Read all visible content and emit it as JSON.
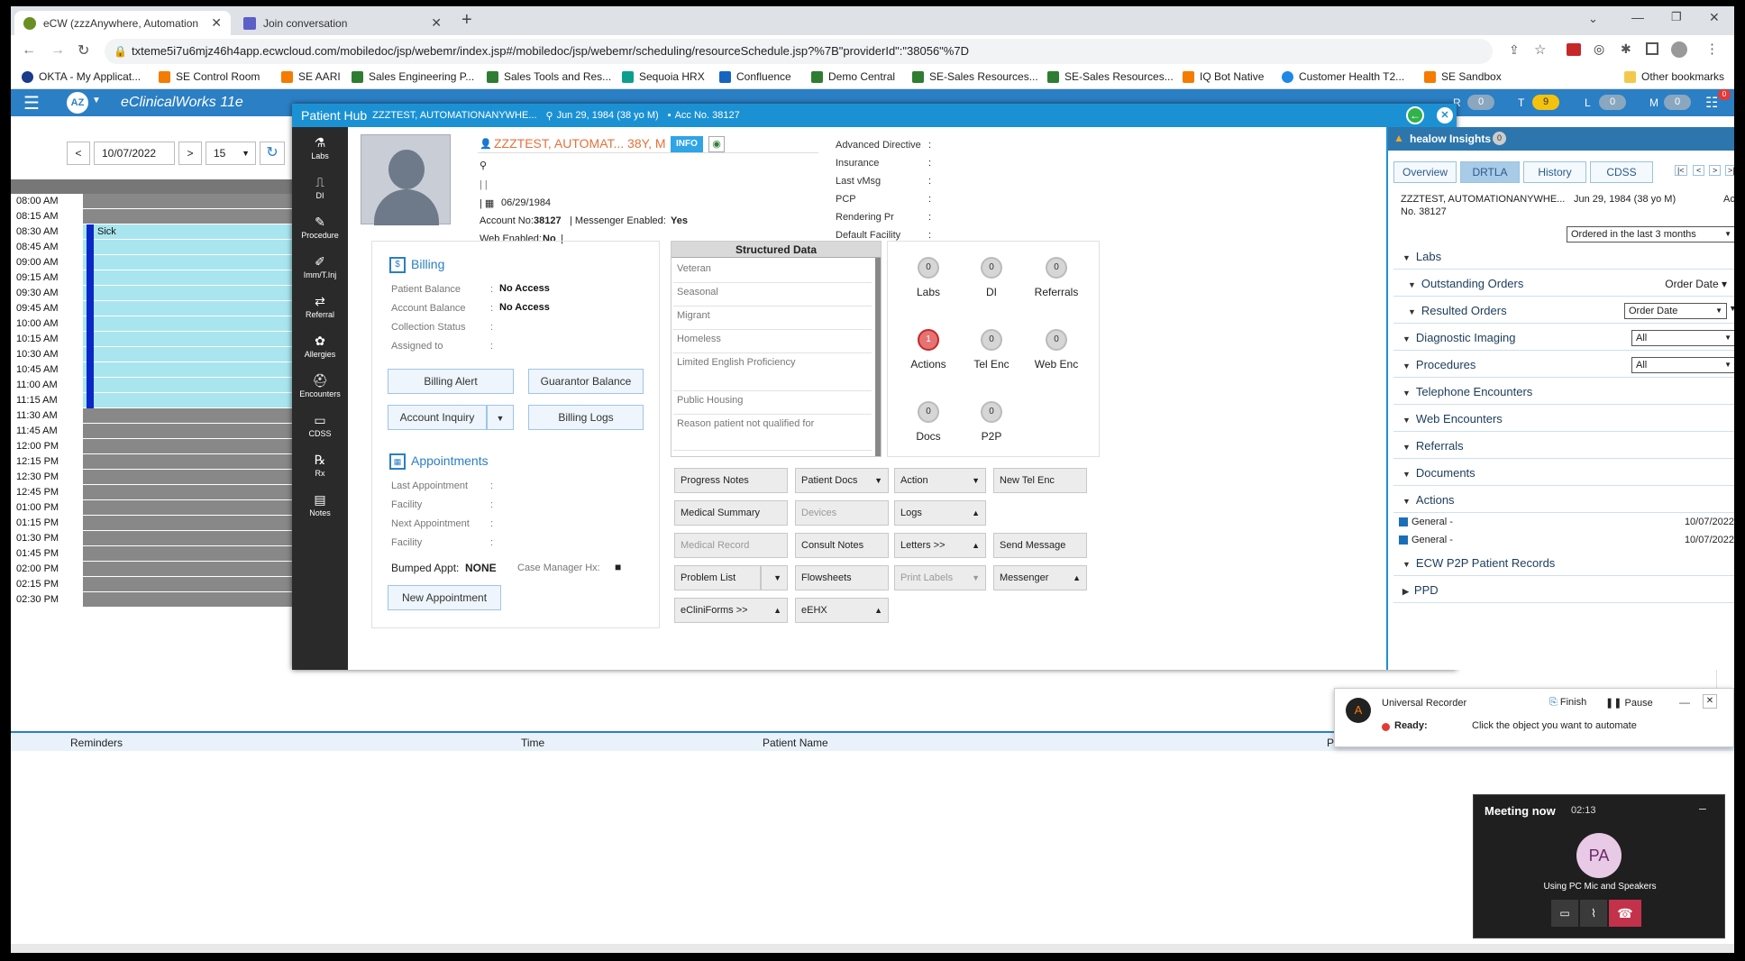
{
  "browser": {
    "tabs": [
      {
        "title": "eCW (zzzAnywhere, Automation",
        "active": true
      },
      {
        "title": "Join conversation",
        "active": false
      }
    ],
    "url": "txteme5i7u6mjz46h4app.ecwcloud.com/mobiledoc/jsp/webemr/index.jsp#/mobiledoc/jsp/webemr/scheduling/resourceSchedule.jsp?%7B\"providerId\":\"38056\"%7D",
    "bookmarks": [
      "OKTA - My Applicat...",
      "SE Control Room",
      "SE AARI",
      "Sales Engineering P...",
      "Sales Tools and Res...",
      "Sequoia HRX",
      "Confluence",
      "Demo Central",
      "SE-Sales Resources...",
      "SE-Sales Resources...",
      "IQ Bot Native",
      "Customer Health T2...",
      "SE Sandbox"
    ],
    "other_bookmarks": "Other bookmarks"
  },
  "app": {
    "avatar": "AZ",
    "title": "eClinicalWorks 11e",
    "badges": [
      {
        "letter": "R",
        "count": "0"
      },
      {
        "letter": "T",
        "count": "9"
      },
      {
        "letter": "L",
        "count": "0"
      },
      {
        "letter": "M",
        "count": "0"
      }
    ],
    "menu_badge": "0"
  },
  "schedule": {
    "date": "10/07/2022",
    "interval": "15",
    "prev": "<",
    "next": ">",
    "appointment_label": "Sick",
    "times": [
      "08:00",
      "08:15",
      "08:30",
      "08:45",
      "09:00",
      "09:15",
      "09:30",
      "09:45",
      "10:00",
      "10:15",
      "10:30",
      "10:45",
      "11:00",
      "11:15",
      "11:30",
      "11:45",
      "12:00",
      "12:15",
      "12:30",
      "12:45",
      "01:00",
      "01:15",
      "01:30",
      "01:45",
      "02:00",
      "02:15",
      "02:30"
    ],
    "ampm": [
      "AM",
      "AM",
      "AM",
      "AM",
      "AM",
      "AM",
      "AM",
      "AM",
      "AM",
      "AM",
      "AM",
      "AM",
      "AM",
      "AM",
      "AM",
      "AM",
      "PM",
      "PM",
      "PM",
      "PM",
      "PM",
      "PM",
      "PM",
      "PM",
      "PM",
      "PM",
      "PM"
    ]
  },
  "reminders": {
    "cols": [
      "Reminders",
      "Time",
      "Patient Name",
      "P"
    ]
  },
  "hub": {
    "title": "Patient Hub",
    "patient_name": "ZZZTEST, AUTOMATIONANYWHE...",
    "dob_info": "Jun 29, 1984 (38 yo M)",
    "acc": "Acc No. 38127",
    "sidebar": [
      "Labs",
      "DI",
      "Procedure",
      "Imm/T.Inj",
      "Referral",
      "Allergies",
      "Encounters",
      "CDSS",
      "Rx",
      "Notes"
    ],
    "header_name": "ZZZTEST, AUTOMAT... 38Y, M",
    "info_badge": "INFO",
    "dob": "06/29/1984",
    "account_no_label": "Account No:",
    "account_no": "38127",
    "messenger_label": "| Messenger Enabled:",
    "messenger": "Yes",
    "web_label": "Web Enabled:",
    "web": "No",
    "right_fields": [
      "Advanced Directive",
      "Insurance",
      "Last vMsg",
      "PCP",
      "Rendering Pr",
      "Default Facility"
    ],
    "billing": {
      "title": "Billing",
      "patient_balance_label": "Patient Balance",
      "patient_balance": "No Access",
      "account_balance_label": "Account Balance",
      "account_balance": "No Access",
      "collection_status_label": "Collection Status",
      "assigned_to_label": "Assigned to",
      "buttons": [
        "Billing Alert",
        "Guarantor Balance",
        "Account Inquiry",
        "Billing Logs"
      ]
    },
    "appointments": {
      "title": "Appointments",
      "fields": [
        "Last Appointment",
        "Facility",
        "Next Appointment",
        "Facility"
      ],
      "bumped_label": "Bumped Appt:",
      "bumped": "NONE",
      "case_mgr": "Case Manager Hx:",
      "new_btn": "New Appointment"
    },
    "structured_data": {
      "title": "Structured Data",
      "items": [
        "Veteran",
        "Seasonal",
        "Migrant",
        "Homeless",
        "Limited English Proficiency",
        "Public Housing",
        "Reason patient not qualified for"
      ]
    },
    "counters": [
      {
        "label": "Labs",
        "count": "0"
      },
      {
        "label": "DI",
        "count": "0"
      },
      {
        "label": "Referrals",
        "count": "0"
      },
      {
        "label": "Actions",
        "count": "1"
      },
      {
        "label": "Tel Enc",
        "count": "0"
      },
      {
        "label": "Web Enc",
        "count": "0"
      },
      {
        "label": "Docs",
        "count": "0"
      },
      {
        "label": "P2P",
        "count": "0"
      }
    ],
    "actions": {
      "progress_notes": "Progress Notes",
      "patient_docs": "Patient Docs",
      "action": "Action",
      "new_tel_enc": "New Tel Enc",
      "medical_summary": "Medical Summary",
      "devices": "Devices",
      "logs": "Logs",
      "medical_record": "Medical Record",
      "consult_notes": "Consult Notes",
      "letters": "Letters   >>",
      "send_message": "Send Message",
      "problem_list": "Problem List",
      "flowsheets": "Flowsheets",
      "print_labels": "Print Labels",
      "messenger": "Messenger",
      "ecliniforms": "eCliniForms  >>",
      "eehx": "eEHX"
    }
  },
  "insights": {
    "title": "healow Insights",
    "count": "0",
    "tabs": [
      "Overview",
      "DRTLA",
      "History",
      "CDSS"
    ],
    "patient": "ZZZTEST, AUTOMATIONANYWHE...",
    "dob": "Jun 29, 1984 (38 yo M)",
    "acc1": "Acc",
    "acc2": "No. 38127",
    "filter": "Ordered in the last 3 months",
    "sections": {
      "labs": "Labs",
      "outstanding": "Outstanding Orders",
      "outstanding_sort": "Order Date",
      "resulted": "Resulted Orders",
      "resulted_sort": "Order Date",
      "diag": "Diagnostic Imaging",
      "diag_filter": "All",
      "procedures": "Procedures",
      "proc_filter": "All",
      "tel": "Telephone Encounters",
      "web": "Web Encounters",
      "referrals": "Referrals",
      "documents": "Documents",
      "actions": "Actions",
      "p2p": "ECW P2P Patient Records",
      "ppd": "PPD"
    },
    "action_items": [
      {
        "label": "General -",
        "date": "10/07/2022"
      },
      {
        "label": "General -",
        "date": "10/07/2022"
      }
    ]
  },
  "recorder": {
    "title": "Universal Recorder",
    "finish": "Finish",
    "pause": "Pause",
    "status_label": "Ready:",
    "status_text": "Click the object you want to automate"
  },
  "meeting": {
    "title": "Meeting now",
    "time": "02:13",
    "initials": "PA",
    "audio": "Using PC Mic and Speakers"
  },
  "colors": {
    "brand": "#2b7fc4",
    "hub_title": "#1b91d4",
    "slot_light": "#a9e5ef",
    "slot_gray": "#888888",
    "appt_purple": "#9b37f0"
  }
}
